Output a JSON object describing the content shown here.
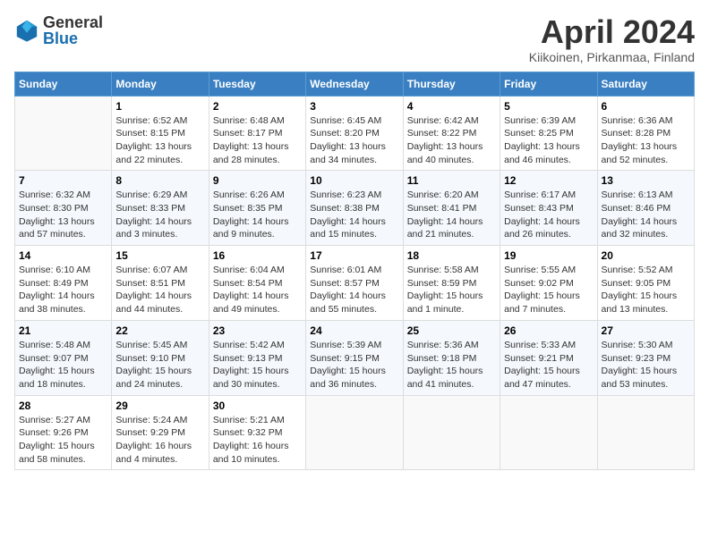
{
  "logo": {
    "general": "General",
    "blue": "Blue"
  },
  "title": "April 2024",
  "location": "Kiikoinen, Pirkanmaa, Finland",
  "weekdays": [
    "Sunday",
    "Monday",
    "Tuesday",
    "Wednesday",
    "Thursday",
    "Friday",
    "Saturday"
  ],
  "weeks": [
    [
      {
        "day": "",
        "info": ""
      },
      {
        "day": "1",
        "info": "Sunrise: 6:52 AM\nSunset: 8:15 PM\nDaylight: 13 hours\nand 22 minutes."
      },
      {
        "day": "2",
        "info": "Sunrise: 6:48 AM\nSunset: 8:17 PM\nDaylight: 13 hours\nand 28 minutes."
      },
      {
        "day": "3",
        "info": "Sunrise: 6:45 AM\nSunset: 8:20 PM\nDaylight: 13 hours\nand 34 minutes."
      },
      {
        "day": "4",
        "info": "Sunrise: 6:42 AM\nSunset: 8:22 PM\nDaylight: 13 hours\nand 40 minutes."
      },
      {
        "day": "5",
        "info": "Sunrise: 6:39 AM\nSunset: 8:25 PM\nDaylight: 13 hours\nand 46 minutes."
      },
      {
        "day": "6",
        "info": "Sunrise: 6:36 AM\nSunset: 8:28 PM\nDaylight: 13 hours\nand 52 minutes."
      }
    ],
    [
      {
        "day": "7",
        "info": "Sunrise: 6:32 AM\nSunset: 8:30 PM\nDaylight: 13 hours\nand 57 minutes."
      },
      {
        "day": "8",
        "info": "Sunrise: 6:29 AM\nSunset: 8:33 PM\nDaylight: 14 hours\nand 3 minutes."
      },
      {
        "day": "9",
        "info": "Sunrise: 6:26 AM\nSunset: 8:35 PM\nDaylight: 14 hours\nand 9 minutes."
      },
      {
        "day": "10",
        "info": "Sunrise: 6:23 AM\nSunset: 8:38 PM\nDaylight: 14 hours\nand 15 minutes."
      },
      {
        "day": "11",
        "info": "Sunrise: 6:20 AM\nSunset: 8:41 PM\nDaylight: 14 hours\nand 21 minutes."
      },
      {
        "day": "12",
        "info": "Sunrise: 6:17 AM\nSunset: 8:43 PM\nDaylight: 14 hours\nand 26 minutes."
      },
      {
        "day": "13",
        "info": "Sunrise: 6:13 AM\nSunset: 8:46 PM\nDaylight: 14 hours\nand 32 minutes."
      }
    ],
    [
      {
        "day": "14",
        "info": "Sunrise: 6:10 AM\nSunset: 8:49 PM\nDaylight: 14 hours\nand 38 minutes."
      },
      {
        "day": "15",
        "info": "Sunrise: 6:07 AM\nSunset: 8:51 PM\nDaylight: 14 hours\nand 44 minutes."
      },
      {
        "day": "16",
        "info": "Sunrise: 6:04 AM\nSunset: 8:54 PM\nDaylight: 14 hours\nand 49 minutes."
      },
      {
        "day": "17",
        "info": "Sunrise: 6:01 AM\nSunset: 8:57 PM\nDaylight: 14 hours\nand 55 minutes."
      },
      {
        "day": "18",
        "info": "Sunrise: 5:58 AM\nSunset: 8:59 PM\nDaylight: 15 hours\nand 1 minute."
      },
      {
        "day": "19",
        "info": "Sunrise: 5:55 AM\nSunset: 9:02 PM\nDaylight: 15 hours\nand 7 minutes."
      },
      {
        "day": "20",
        "info": "Sunrise: 5:52 AM\nSunset: 9:05 PM\nDaylight: 15 hours\nand 13 minutes."
      }
    ],
    [
      {
        "day": "21",
        "info": "Sunrise: 5:48 AM\nSunset: 9:07 PM\nDaylight: 15 hours\nand 18 minutes."
      },
      {
        "day": "22",
        "info": "Sunrise: 5:45 AM\nSunset: 9:10 PM\nDaylight: 15 hours\nand 24 minutes."
      },
      {
        "day": "23",
        "info": "Sunrise: 5:42 AM\nSunset: 9:13 PM\nDaylight: 15 hours\nand 30 minutes."
      },
      {
        "day": "24",
        "info": "Sunrise: 5:39 AM\nSunset: 9:15 PM\nDaylight: 15 hours\nand 36 minutes."
      },
      {
        "day": "25",
        "info": "Sunrise: 5:36 AM\nSunset: 9:18 PM\nDaylight: 15 hours\nand 41 minutes."
      },
      {
        "day": "26",
        "info": "Sunrise: 5:33 AM\nSunset: 9:21 PM\nDaylight: 15 hours\nand 47 minutes."
      },
      {
        "day": "27",
        "info": "Sunrise: 5:30 AM\nSunset: 9:23 PM\nDaylight: 15 hours\nand 53 minutes."
      }
    ],
    [
      {
        "day": "28",
        "info": "Sunrise: 5:27 AM\nSunset: 9:26 PM\nDaylight: 15 hours\nand 58 minutes."
      },
      {
        "day": "29",
        "info": "Sunrise: 5:24 AM\nSunset: 9:29 PM\nDaylight: 16 hours\nand 4 minutes."
      },
      {
        "day": "30",
        "info": "Sunrise: 5:21 AM\nSunset: 9:32 PM\nDaylight: 16 hours\nand 10 minutes."
      },
      {
        "day": "",
        "info": ""
      },
      {
        "day": "",
        "info": ""
      },
      {
        "day": "",
        "info": ""
      },
      {
        "day": "",
        "info": ""
      }
    ]
  ]
}
